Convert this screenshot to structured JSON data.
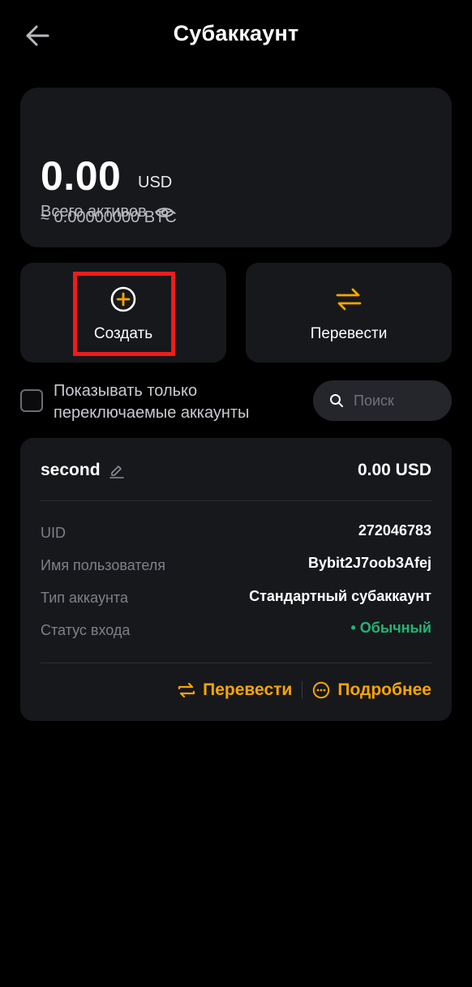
{
  "header": {
    "title": "Субаккаунт",
    "back_icon": "arrow-left-icon"
  },
  "assets": {
    "label": "Всего активов",
    "value": "0.00",
    "currency": "USD",
    "btc_equivalent": "≈ 0.00000000 BTC"
  },
  "actions": {
    "create_label": "Создать",
    "transfer_label": "Перевести",
    "highlight_color": "#ee1c1c"
  },
  "filter": {
    "checkbox_label": "Показывать только переключаемые аккаунты",
    "checked": false,
    "search_placeholder": "Поиск"
  },
  "account": {
    "name": "second",
    "balance": "0.00 USD",
    "rows": [
      {
        "label": "UID",
        "value": "272046783"
      },
      {
        "label": "Имя пользователя",
        "value": "Bybit2J7oob3Afej"
      },
      {
        "label": "Тип аккаунта",
        "value": "Стандартный субаккаунт"
      },
      {
        "label": "Статус входа",
        "value": "• Обычный"
      }
    ],
    "transfer_label": "Перевести",
    "details_label": "Подробнее"
  },
  "colors": {
    "background": "#000000",
    "card": "#17181c",
    "accent": "#f7a600",
    "status_ok": "#21b573"
  }
}
